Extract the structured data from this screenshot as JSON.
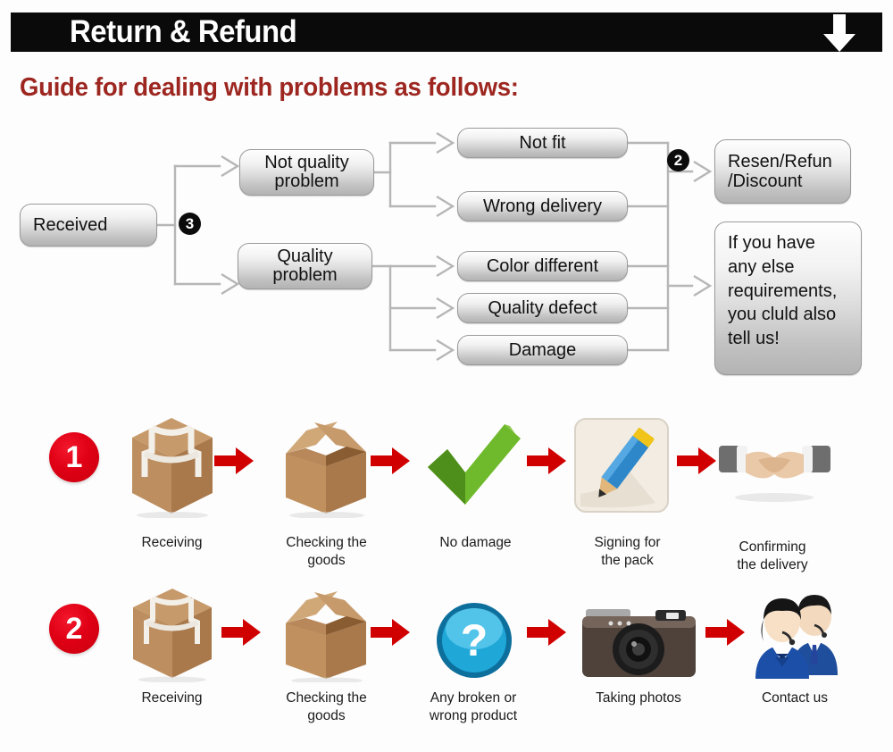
{
  "header": {
    "title": "Return & Refund",
    "arrow_icon": "down-arrow-icon",
    "bar_color": "#0a0a0a",
    "title_color": "#ffffff"
  },
  "guide": {
    "title": "Guide for dealing with problems as follows:",
    "color": "#9d2720"
  },
  "flowchart": {
    "nodes": [
      {
        "id": "received",
        "label": "Received"
      },
      {
        "id": "not-quality",
        "label": "Not quality\nproblem"
      },
      {
        "id": "quality",
        "label": "Quality\nproblem"
      },
      {
        "id": "not-fit",
        "label": "Not fit"
      },
      {
        "id": "wrong-delivery",
        "label": "Wrong delivery"
      },
      {
        "id": "color-different",
        "label": "Color different"
      },
      {
        "id": "quality-defect",
        "label": "Quality defect"
      },
      {
        "id": "damage",
        "label": "Damage"
      },
      {
        "id": "resend-refund",
        "label": "Resen/Refun\n/Discount"
      },
      {
        "id": "any-else",
        "label": "If you have\nany else\nrequirements,\nyou cluld also\ntell us!"
      }
    ],
    "badges": [
      {
        "id": "badge-3",
        "label": "3"
      },
      {
        "id": "badge-2",
        "label": "2"
      }
    ],
    "line_color": "#b6b6b6",
    "node_border_color": "#9a9a9a"
  },
  "process": {
    "arrow_color": "#d10000",
    "badge_color": "#e00015",
    "rows": [
      {
        "number": "1",
        "steps": [
          {
            "icon": "closed-box-icon",
            "label": "Receiving"
          },
          {
            "icon": "open-box-icon",
            "label": "Checking the\ngoods"
          },
          {
            "icon": "green-check-icon",
            "label": "No damage"
          },
          {
            "icon": "pencil-sign-icon",
            "label": "Signing for\nthe pack"
          },
          {
            "icon": "handshake-icon",
            "label": "Confirming\nthe delivery"
          }
        ]
      },
      {
        "number": "2",
        "steps": [
          {
            "icon": "closed-box-icon",
            "label": "Receiving"
          },
          {
            "icon": "open-box-icon",
            "label": "Checking the\ngoods"
          },
          {
            "icon": "question-mark-icon",
            "label": "Any broken or\nwrong product"
          },
          {
            "icon": "camera-icon",
            "label": "Taking photos"
          },
          {
            "icon": "support-people-icon",
            "label": "Contact us"
          }
        ]
      }
    ]
  }
}
